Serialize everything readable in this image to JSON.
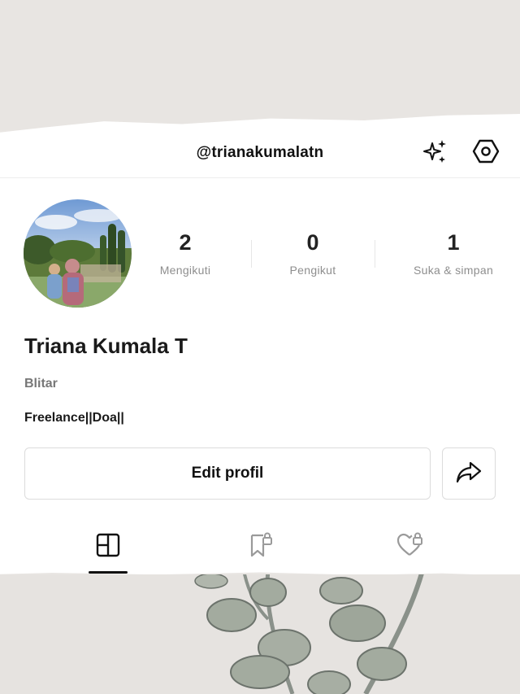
{
  "header": {
    "handle": "@trianakumalatn",
    "icons": {
      "sparkle": "sparkle-icon",
      "settings": "settings-hex-icon"
    }
  },
  "profile": {
    "name": "Triana Kumala T",
    "location": "Blitar",
    "bio": "Freelance||Doa||",
    "avatar_icon": "profile-photo"
  },
  "stats": [
    {
      "value": "2",
      "label": "Mengikuti"
    },
    {
      "value": "0",
      "label": "Pengikut"
    },
    {
      "value": "1",
      "label": "Suka & simpan"
    }
  ],
  "actions": {
    "edit_label": "Edit profil",
    "share_icon": "share-arrow-icon"
  },
  "tabs": [
    {
      "icon": "grid-icon",
      "active": true
    },
    {
      "icon": "bookmark-lock-icon",
      "active": false
    },
    {
      "icon": "heart-lock-icon",
      "active": false
    }
  ],
  "colors": {
    "background": "#e9e6e3",
    "card": "#ffffff",
    "muted_text": "#8e8e8e"
  }
}
